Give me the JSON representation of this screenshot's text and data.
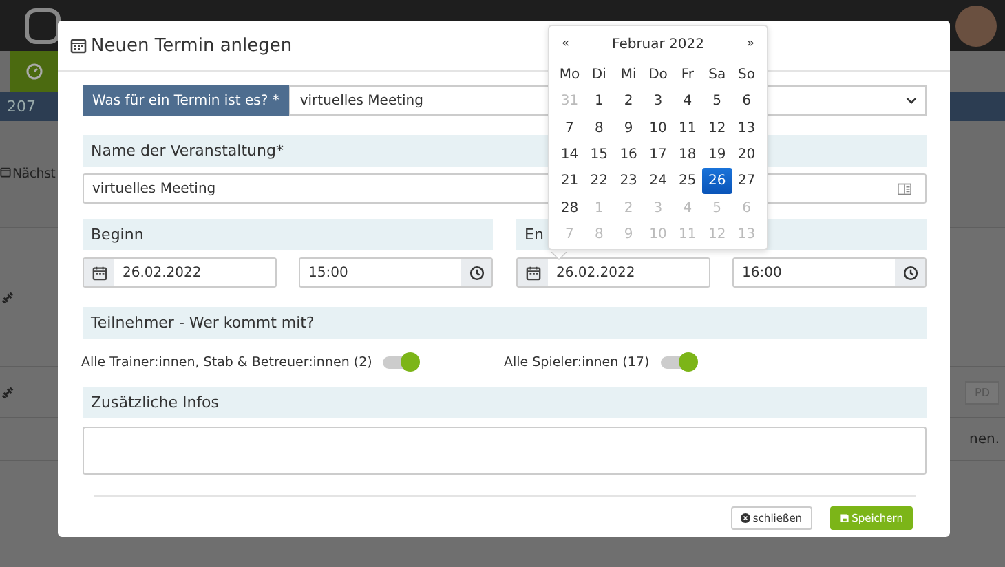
{
  "background": {
    "counter": "207",
    "section_title": "Nächst",
    "pdf_button": "PD",
    "row_text": "nen."
  },
  "modal": {
    "title": "Neuen Termin anlegen",
    "type_field": {
      "label": "Was für ein Termin ist es? *",
      "value": "virtuelles Meeting"
    },
    "name_field": {
      "label": "Name der Veranstaltung*",
      "value": "virtuelles Meeting"
    },
    "begin": {
      "label": "Beginn",
      "date": "26.02.2022",
      "time": "15:00"
    },
    "end": {
      "label": "En",
      "date": "26.02.2022",
      "time": "16:00"
    },
    "participants": {
      "label": "Teilnehmer - Wer kommt mit?",
      "toggles": [
        {
          "label": "Alle Trainer:innen, Stab & Betreuer:innen (2)",
          "on": true
        },
        {
          "label": "Alle Spieler:innen (17)",
          "on": true
        }
      ]
    },
    "info": {
      "label": "Zusätzliche Infos"
    },
    "buttons": [
      {
        "label": "schließen",
        "kind": "close"
      },
      {
        "label": "Speichern",
        "kind": "save"
      }
    ]
  },
  "datepicker": {
    "prev": "«",
    "title": "Februar 2022",
    "next": "»",
    "weekdays": [
      "Mo",
      "Di",
      "Mi",
      "Do",
      "Fr",
      "Sa",
      "So"
    ],
    "weeks": [
      [
        {
          "day": "31",
          "muted": true,
          "selected": false
        },
        {
          "day": "1",
          "muted": false,
          "selected": false
        },
        {
          "day": "2",
          "muted": false,
          "selected": false
        },
        {
          "day": "3",
          "muted": false,
          "selected": false
        },
        {
          "day": "4",
          "muted": false,
          "selected": false
        },
        {
          "day": "5",
          "muted": false,
          "selected": false
        },
        {
          "day": "6",
          "muted": false,
          "selected": false
        }
      ],
      [
        {
          "day": "7",
          "muted": false,
          "selected": false
        },
        {
          "day": "8",
          "muted": false,
          "selected": false
        },
        {
          "day": "9",
          "muted": false,
          "selected": false
        },
        {
          "day": "10",
          "muted": false,
          "selected": false
        },
        {
          "day": "11",
          "muted": false,
          "selected": false
        },
        {
          "day": "12",
          "muted": false,
          "selected": false
        },
        {
          "day": "13",
          "muted": false,
          "selected": false
        }
      ],
      [
        {
          "day": "14",
          "muted": false,
          "selected": false
        },
        {
          "day": "15",
          "muted": false,
          "selected": false
        },
        {
          "day": "16",
          "muted": false,
          "selected": false
        },
        {
          "day": "17",
          "muted": false,
          "selected": false
        },
        {
          "day": "18",
          "muted": false,
          "selected": false
        },
        {
          "day": "19",
          "muted": false,
          "selected": false
        },
        {
          "day": "20",
          "muted": false,
          "selected": false
        }
      ],
      [
        {
          "day": "21",
          "muted": false,
          "selected": false
        },
        {
          "day": "22",
          "muted": false,
          "selected": false
        },
        {
          "day": "23",
          "muted": false,
          "selected": false
        },
        {
          "day": "24",
          "muted": false,
          "selected": false
        },
        {
          "day": "25",
          "muted": false,
          "selected": false
        },
        {
          "day": "26",
          "muted": false,
          "selected": true
        },
        {
          "day": "27",
          "muted": false,
          "selected": false
        }
      ],
      [
        {
          "day": "28",
          "muted": false,
          "selected": false
        },
        {
          "day": "1",
          "muted": true,
          "selected": false
        },
        {
          "day": "2",
          "muted": true,
          "selected": false
        },
        {
          "day": "3",
          "muted": true,
          "selected": false
        },
        {
          "day": "4",
          "muted": true,
          "selected": false
        },
        {
          "day": "5",
          "muted": true,
          "selected": false
        },
        {
          "day": "6",
          "muted": true,
          "selected": false
        }
      ],
      [
        {
          "day": "7",
          "muted": true,
          "selected": false
        },
        {
          "day": "8",
          "muted": true,
          "selected": false
        },
        {
          "day": "9",
          "muted": true,
          "selected": false
        },
        {
          "day": "10",
          "muted": true,
          "selected": false
        },
        {
          "day": "11",
          "muted": true,
          "selected": false
        },
        {
          "day": "12",
          "muted": true,
          "selected": false
        },
        {
          "day": "13",
          "muted": true,
          "selected": false
        }
      ]
    ]
  }
}
